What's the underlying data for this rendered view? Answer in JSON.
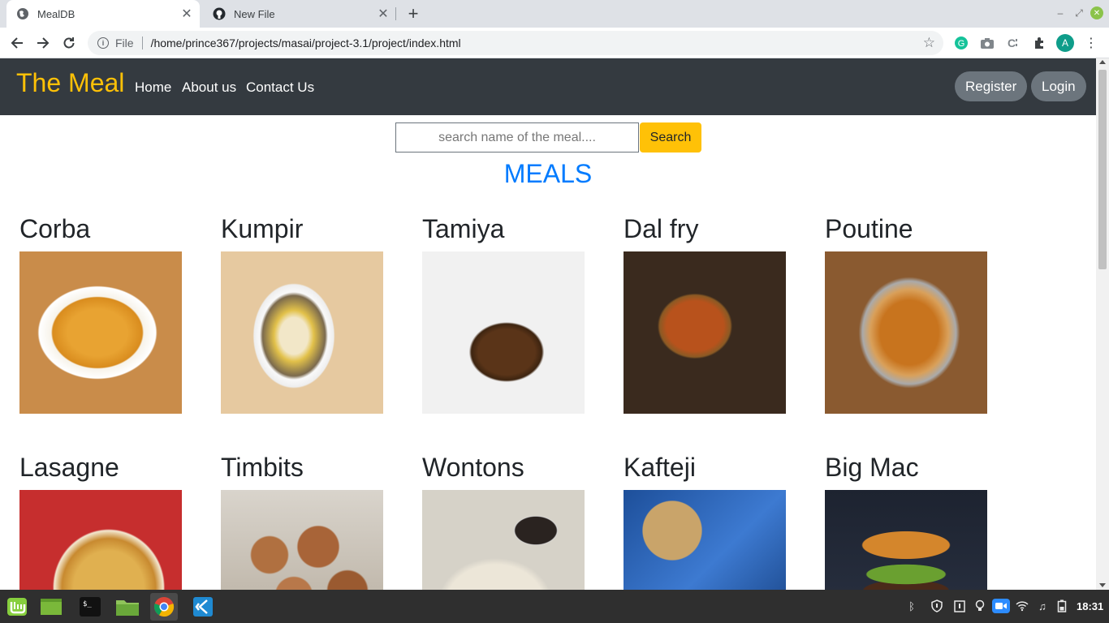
{
  "browser": {
    "tabs": [
      {
        "title": "MealDB",
        "favicon": "globe-icon",
        "active": true
      },
      {
        "title": "New File",
        "favicon": "github-icon",
        "active": false
      }
    ],
    "address": {
      "scheme": "File",
      "url": "/home/prince367/projects/masai/project-3.1/project/index.html"
    },
    "extensions": [
      "grammarly-icon",
      "camera-icon",
      "code-icon",
      "puzzle-icon"
    ],
    "profile_initial": "A"
  },
  "site": {
    "brand": "The Meal",
    "nav": [
      "Home",
      "About us",
      "Contact Us"
    ],
    "register": "Register",
    "login": "Login",
    "search": {
      "placeholder": "search name of the meal....",
      "value": "",
      "button": "Search"
    },
    "heading": "MEALS",
    "meals": [
      {
        "name": "Corba"
      },
      {
        "name": "Kumpir"
      },
      {
        "name": "Tamiya"
      },
      {
        "name": "Dal fry"
      },
      {
        "name": "Poutine"
      },
      {
        "name": "Lasagne"
      },
      {
        "name": "Timbits"
      },
      {
        "name": "Wontons"
      },
      {
        "name": "Kafteji"
      },
      {
        "name": "Big Mac"
      }
    ]
  },
  "taskbar": {
    "apps": [
      "mint-menu-icon",
      "show-desktop-icon",
      "terminal-icon",
      "files-icon",
      "chrome-icon",
      "vscode-icon"
    ],
    "tray": [
      "bluetooth-icon",
      "shield-icon",
      "clipboard-icon",
      "bulb-icon",
      "zoom-icon",
      "wifi-icon",
      "music-icon",
      "battery-icon"
    ],
    "clock": "18:31"
  }
}
